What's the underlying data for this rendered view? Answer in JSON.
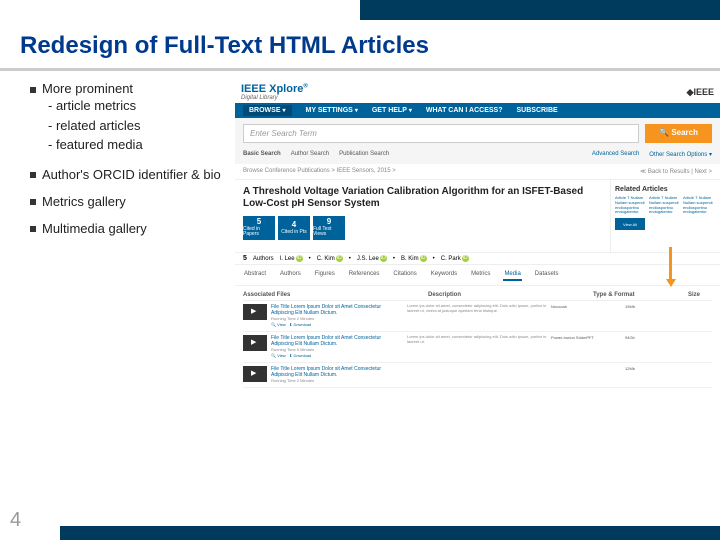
{
  "title": "Redesign of Full-Text HTML Articles",
  "bullets": [
    {
      "text": "More prominent",
      "subs": [
        "article metrics",
        "related articles",
        "featured media"
      ]
    },
    {
      "text": "Author's ORCID identifier & bio"
    },
    {
      "text": "Metrics gallery"
    },
    {
      "text": "Multimedia gallery"
    }
  ],
  "xplore": {
    "logo": "IEEE Xplore",
    "sub": "Digital Library",
    "ieee": "◆IEEE"
  },
  "nav": {
    "browse": "BROWSE",
    "settings": "MY SETTINGS",
    "help": "GET HELP",
    "access": "WHAT CAN I ACCESS?",
    "subscribe": "SUBSCRIBE"
  },
  "search": {
    "placeholder": "Enter Search Term",
    "btn": "Search"
  },
  "subsearch": {
    "basic": "Basic Search",
    "author": "Author Search",
    "pub": "Publication Search",
    "adv": "Advanced Search",
    "other": "Other Search Options ▾"
  },
  "crumb": {
    "path": "Browse Conference Publications > IEEE Sensors, 2015 >",
    "back": "≪ Back to Results | Next >"
  },
  "article": {
    "title": "A Threshold Voltage Variation Calibration Algorithm for an ISFET-Based Low-Cost pH Sensor System",
    "metrics": [
      {
        "n": "5",
        "t": "Cited in Papers"
      },
      {
        "n": "4",
        "t": "Cited in Pts"
      },
      {
        "n": "9",
        "t": "Full Text Views"
      }
    ]
  },
  "related": {
    "h": "Related Articles",
    "it": "Article T Nullam Nullam suspendi endlosportinu endogatentur.",
    "va": "View All"
  },
  "authors": {
    "n": "5",
    "lab": "Authors",
    "list": [
      "I. Lee",
      "C. Kim",
      "J.S. Lee",
      "B. Kim",
      "C. Park"
    ]
  },
  "tabs": [
    "Abstract",
    "Authors",
    "Figures",
    "References",
    "Citations",
    "Keywords",
    "Metrics",
    "Media",
    "Datasets"
  ],
  "cols": {
    "af": "Associated Files",
    "d": "Description",
    "tf": "Type & Format",
    "s": "Size"
  },
  "files": [
    {
      "t": "File Title Lorem Ipsum Dolor sit Amet Consectetur Adipiscing Elit Nullam Dictum.",
      "m": "Running Time 2 Minutes",
      "d": "Lorem ips dolor sit amet, consectetur adipiscing elit. Duis odio ipsum, porttor in laoreet ut, vivera at justoque aperiam feria tristique.",
      "tf": "Novocab",
      "s": "15Mb"
    },
    {
      "t": "File Title Lorem Ipsum Dolor sit Amet Consectetur Adipiscing Elit Nullam Dictum.",
      "m": "Running Time 5 Minutes",
      "d": "Lorem ips dolor sit amet, consectetur adipiscing elit. Duis odio ipsum, porttor in laoreet ut.",
      "tf": "Power-horion SüdmPFT",
      "s": "94Gb"
    },
    {
      "t": "File Title Lorem Ipsum Dolor sit Amet Consectetur Adipiscing Elit Nullam Dictum.",
      "m": "Running Time 2 Minutes",
      "d": "",
      "tf": "",
      "s": "12Mb"
    }
  ],
  "pg": "4"
}
